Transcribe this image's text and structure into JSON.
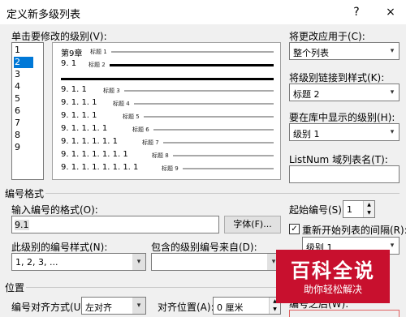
{
  "dialog": {
    "title": "定义新多级列表",
    "help": "?",
    "close": "×"
  },
  "level_section": {
    "label": "单击要修改的级别(V):",
    "levels": [
      "1",
      "2",
      "3",
      "4",
      "5",
      "6",
      "7",
      "8",
      "9"
    ],
    "selected_index": 1
  },
  "preview": {
    "rows": [
      {
        "num": "第9章",
        "cap": "标题 1"
      },
      {
        "num": "9. 1",
        "cap": "标题 2"
      },
      {
        "num": "",
        "cap": ""
      },
      {
        "num": "9. 1. 1",
        "cap": "标题 3"
      },
      {
        "num": "9. 1. 1. 1",
        "cap": "标题 4"
      },
      {
        "num": "9. 1. 1. 1",
        "cap": "标题 5"
      },
      {
        "num": "9. 1. 1. 1. 1",
        "cap": "标题 6"
      },
      {
        "num": "9. 1. 1. 1. 1. 1",
        "cap": "标题 7"
      },
      {
        "num": "9. 1. 1. 1. 1. 1. 1",
        "cap": "标题 8"
      },
      {
        "num": "9. 1. 1. 1. 1. 1. 1. 1",
        "cap": "标题 9"
      }
    ]
  },
  "right_panel": {
    "apply_label": "将更改应用于(C):",
    "apply_value": "整个列表",
    "link_label": "将级别链接到样式(K):",
    "link_value": "标题 2",
    "gallery_label": "要在库中显示的级别(H):",
    "gallery_value": "级别 1",
    "listnum_label": "ListNum 域列表名(T):",
    "listnum_value": ""
  },
  "number_format": {
    "section_label": "编号格式",
    "format_label": "输入编号的格式(O):",
    "format_value": "9.1",
    "font_button": "字体(F)...",
    "style_label": "此级别的编号样式(N):",
    "style_value": "1, 2, 3, ...",
    "include_label": "包含的级别编号来自(D):",
    "include_value": "",
    "start_label": "起始编号(S):",
    "start_value": "1",
    "restart_label": "重新开始列表的间隔(R):",
    "restart_checked": true,
    "restart_value": "级别 1"
  },
  "position": {
    "section_label": "位置",
    "align_label": "编号对齐方式(U):",
    "align_value": "左对齐",
    "align_at_label": "对齐位置(A):",
    "align_at_value": "0 厘米",
    "after_label": "编号之后(W):"
  },
  "watermark": {
    "title": "百科全说",
    "subtitle": "助你轻松解决"
  }
}
